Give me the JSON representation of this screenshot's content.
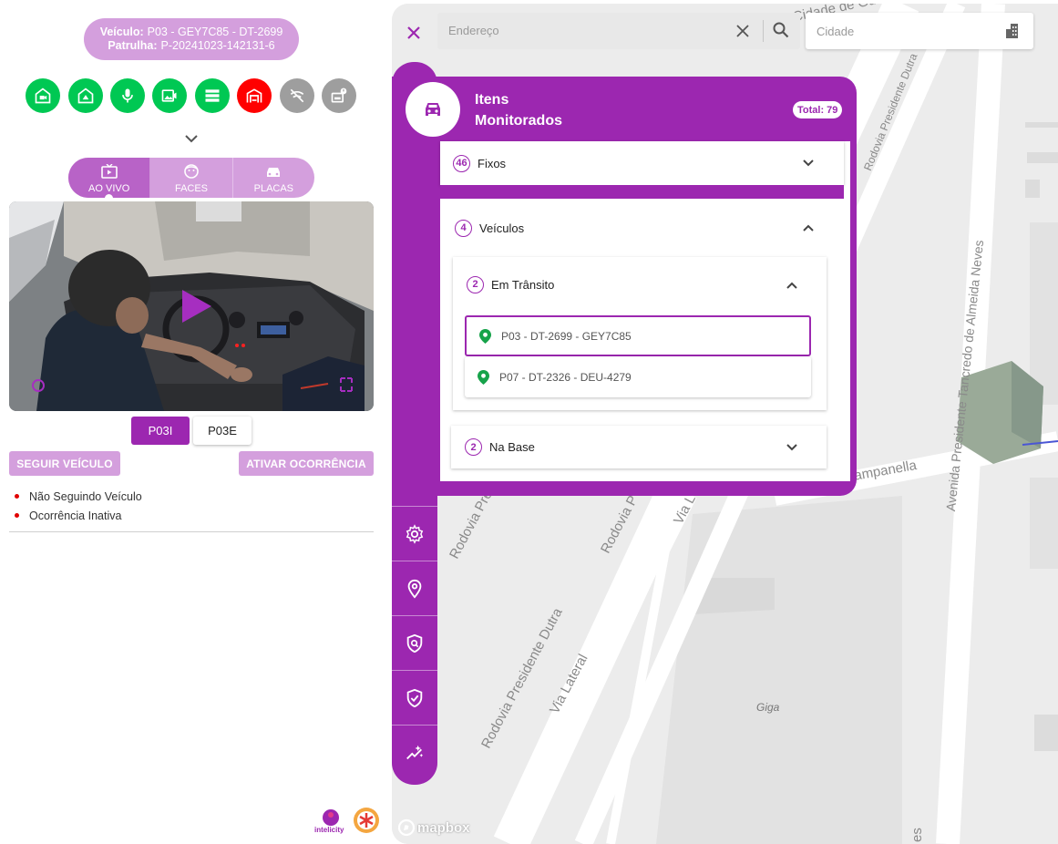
{
  "vehicle_info": {
    "vehicle_label": "Veículo:",
    "vehicle_value": "P03 - GEY7C85 - DT-2699",
    "patrol_label": "Patrulha:",
    "patrol_value": "P-20241023-142131-6"
  },
  "status_icons": [
    {
      "icon": "home-camera-icon",
      "color": "#00c853"
    },
    {
      "icon": "home-alert-icon",
      "color": "#00c853"
    },
    {
      "icon": "microphone-icon",
      "color": "#00c853"
    },
    {
      "icon": "video-image-icon",
      "color": "#00c853"
    },
    {
      "icon": "server-icon",
      "color": "#00c853"
    },
    {
      "icon": "garage-icon",
      "color": "#ff0000"
    },
    {
      "icon": "signal-off-icon",
      "color": "#9e9e9e"
    },
    {
      "icon": "device-alert-icon",
      "color": "#9e9e9e"
    }
  ],
  "view_tabs": [
    {
      "label": "AO VIVO",
      "icon": "tv-icon",
      "active": true
    },
    {
      "label": "FACES",
      "icon": "face-icon",
      "active": false
    },
    {
      "label": "PLACAS",
      "icon": "car-icon",
      "active": false
    }
  ],
  "cameras": {
    "active": "P03I",
    "inactive": "P03E"
  },
  "actions": {
    "follow_vehicle": "SEGUIR VEÍCULO",
    "activate_incident": "ATIVAR OCORRÊNCIA"
  },
  "status_list": [
    "Não Seguindo Veículo",
    "Ocorrência Inativa"
  ],
  "logos": {
    "brand": "intelicity"
  },
  "search": {
    "address_placeholder": "Endereço",
    "city_placeholder": "Cidade"
  },
  "monitored": {
    "title_line1": "Itens",
    "title_line2": "Monitorados",
    "total_label": "Total: 79",
    "groups": {
      "fixed": {
        "count": "46",
        "label": "Fixos"
      },
      "vehicles": {
        "count": "4",
        "label": "Veículos"
      },
      "in_transit": {
        "count": "2",
        "label": "Em Trânsito"
      },
      "at_base": {
        "count": "2",
        "label": "Na Base"
      }
    },
    "vehicle_items": [
      "P03 - DT-2699 - GEY7C85",
      "P07 - DT-2326 - DEU-4279"
    ]
  },
  "map_labels": {
    "viaduto": "Viaduto Cidade de Guarulhos",
    "rodovia_dutra_1": "Rodovia Presidente Dutra",
    "rodovia_dutra_2": "Rodovia Presidente Dutra",
    "rodovia_pre": "Rodovia Pre",
    "rodovia_p": "Rodovia P",
    "via_lateral": "Via Lateral",
    "via_l": "Via L",
    "avenida": "Avenida Presidente Tancredo de Almeida Neves",
    "campanella": "ampanella",
    "giga": "Giga",
    "es": "es",
    "mapbox": "mapbox"
  },
  "colors": {
    "primary": "#9c27b0",
    "primary_light": "#d49fdd",
    "green": "#00c853",
    "red": "#ff0000",
    "gray": "#9e9e9e"
  }
}
